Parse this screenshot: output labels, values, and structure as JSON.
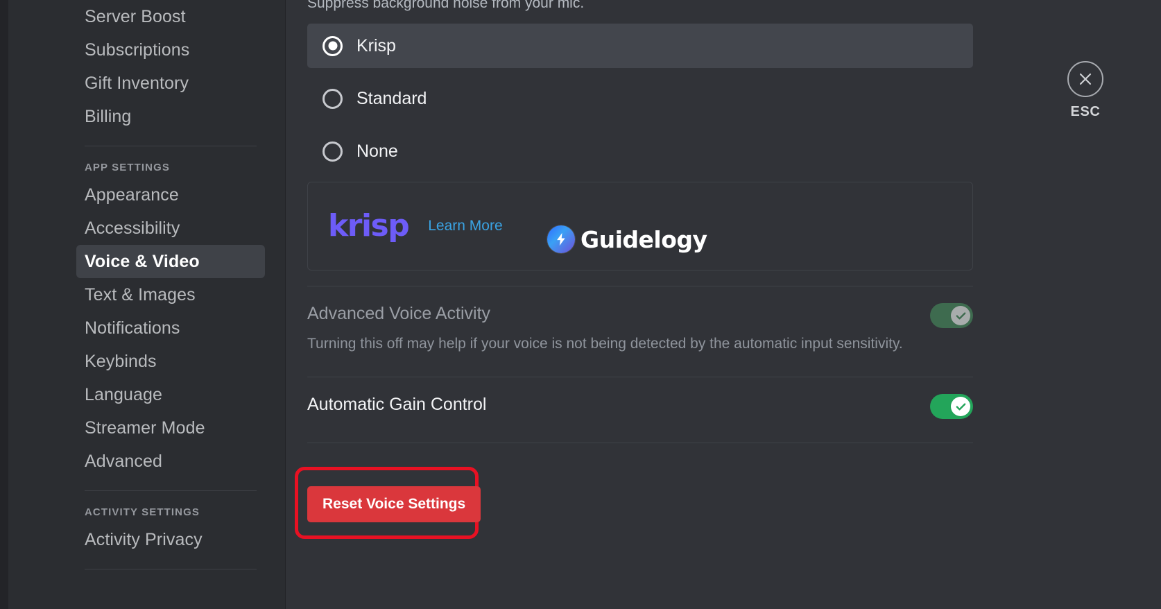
{
  "sidebar": {
    "top_items": [
      {
        "label": "Server Boost",
        "active": false
      },
      {
        "label": "Subscriptions",
        "active": false
      },
      {
        "label": "Gift Inventory",
        "active": false
      },
      {
        "label": "Billing",
        "active": false
      }
    ],
    "app_settings_header": "APP SETTINGS",
    "app_items": [
      {
        "label": "Appearance",
        "active": false
      },
      {
        "label": "Accessibility",
        "active": false
      },
      {
        "label": "Voice & Video",
        "active": true
      },
      {
        "label": "Text & Images",
        "active": false
      },
      {
        "label": "Notifications",
        "active": false
      },
      {
        "label": "Keybinds",
        "active": false
      },
      {
        "label": "Language",
        "active": false
      },
      {
        "label": "Streamer Mode",
        "active": false
      },
      {
        "label": "Advanced",
        "active": false
      }
    ],
    "activity_settings_header": "ACTIVITY SETTINGS",
    "activity_items": [
      {
        "label": "Activity Privacy",
        "active": false
      }
    ]
  },
  "main": {
    "noise_suppression_description": "Suppress background noise from your mic.",
    "noise_options": [
      {
        "label": "Krisp",
        "selected": true
      },
      {
        "label": "Standard",
        "selected": false
      },
      {
        "label": "None",
        "selected": false
      }
    ],
    "promo": {
      "brand": "krisp",
      "link_label": "Learn More",
      "brand_color": "#6d5cf8",
      "link_color": "#3aa3e3"
    },
    "watermark": {
      "text": "Guidelogy",
      "icon": "lightning-bolt-icon"
    },
    "settings": [
      {
        "title": "Advanced Voice Activity",
        "description": "Turning this off may help if your voice is not being detected by the automatic input sensitivity.",
        "toggle_state": "on",
        "toggle_style": "dim",
        "toggle_color": "#3e6b4f"
      },
      {
        "title": "Automatic Gain Control",
        "description": "",
        "toggle_state": "on",
        "toggle_style": "bright",
        "toggle_color": "#23a55a"
      }
    ],
    "reset_button": {
      "label": "Reset Voice Settings",
      "color": "#da373c",
      "highlight_color": "#e81123"
    }
  },
  "close": {
    "label": "ESC",
    "icon": "close-icon"
  }
}
